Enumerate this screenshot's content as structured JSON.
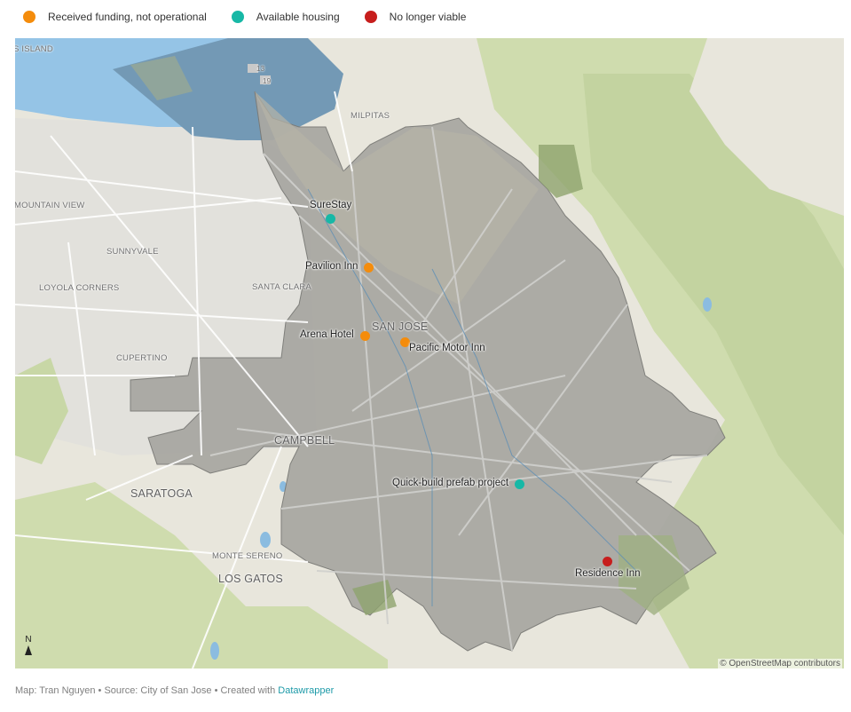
{
  "legend": {
    "items": [
      {
        "label": "Received funding, not operational",
        "color": "#f48c0c"
      },
      {
        "label": "Available housing",
        "color": "#17b8a6"
      },
      {
        "label": "No longer viable",
        "color": "#c71e1d"
      }
    ]
  },
  "map": {
    "place_labels": {
      "island": "S ISLAND",
      "milpitas": "MILPITAS",
      "mountain_view": "MOUNTAIN VIEW",
      "sunnyvale": "SUNNYVALE",
      "loyola_corners": "LOYOLA CORNERS",
      "santa_clara": "SANTA CLARA",
      "san_jose": "SAN JOSE",
      "cupertino": "CUPERTINO",
      "campbell": "CAMPBELL",
      "saratoga": "SARATOGA",
      "monte_sereno": "MONTE SERENO",
      "los_gatos": "LOS GATOS",
      "route_13": "13",
      "route_19": "19"
    },
    "markers": [
      {
        "label": "SureStay",
        "status": "Available housing",
        "color": "#17b8a6"
      },
      {
        "label": "Pavilion Inn",
        "status": "Received funding, not operational",
        "color": "#f48c0c"
      },
      {
        "label": "Arena Hotel",
        "status": "Received funding, not operational",
        "color": "#f48c0c"
      },
      {
        "label": "Pacific Motor Inn",
        "status": "Received funding, not operational",
        "color": "#f48c0c"
      },
      {
        "label": "Quick-build prefab project",
        "status": "Available housing",
        "color": "#17b8a6"
      },
      {
        "label": "Residence Inn",
        "status": "No longer viable",
        "color": "#c71e1d"
      }
    ],
    "north_label": "N",
    "attribution": "© OpenStreetMap contributors"
  },
  "footer": {
    "text": "Map: Tran Nguyen • Source: City of San Jose • Created with ",
    "link": "Datawrapper"
  }
}
